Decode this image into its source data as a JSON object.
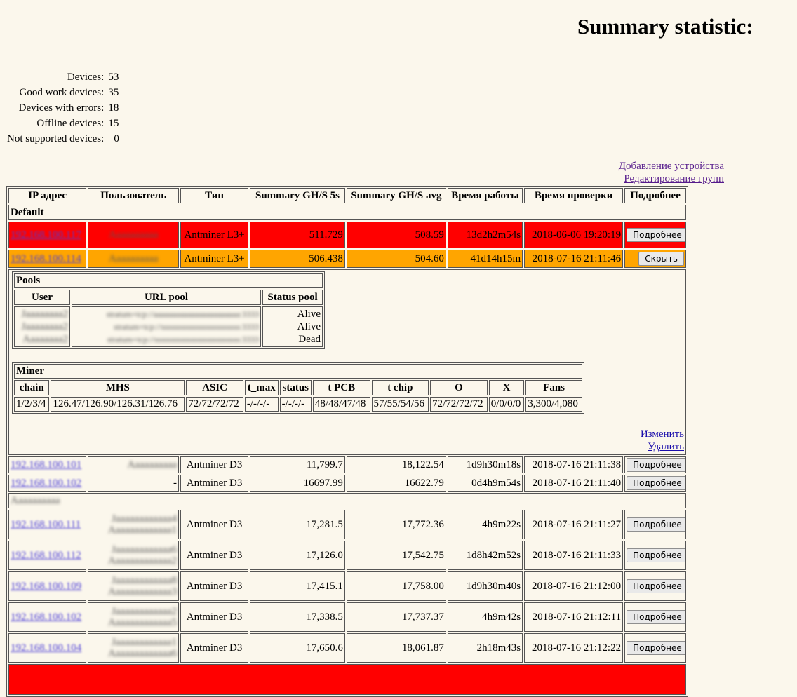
{
  "page": {
    "title": "Summary statistic:"
  },
  "stats": [
    {
      "label": "Devices:",
      "value": "53"
    },
    {
      "label": "Good work devices:",
      "value": "35"
    },
    {
      "label": "Devices with errors:",
      "value": "18"
    },
    {
      "label": "Offline devices:",
      "value": "15"
    },
    {
      "label": "Not supported devices:",
      "value": "0"
    }
  ],
  "links": {
    "add_device": "Добавление устройства",
    "edit_groups": "Редактирование групп"
  },
  "columns": [
    "IP адрес",
    "Пользователь",
    "Тип",
    "Summary GH/S 5s",
    "Summary GH/S avg",
    "Время работы",
    "Время проверки",
    "Подробнее"
  ],
  "groups": {
    "default": "Default",
    "second_masked": "Аааааааааа"
  },
  "rows": [
    {
      "ip": "192.168.100.117",
      "user": "Аааааааааа",
      "type": "Antminer L3+",
      "gh5s": "511.729",
      "ghavg": "508.59",
      "uptime": "13d2h2m54s",
      "checked": "2018-06-06 19:20:19",
      "btn": "Подробнее",
      "status": "red"
    },
    {
      "ip": "192.168.100.114",
      "user": "Аааааааааа",
      "type": "Antminer L3+",
      "gh5s": "506.438",
      "ghavg": "504.60",
      "uptime": "41d14h15m",
      "checked": "2018-07-16 21:11:46",
      "btn": "Скрыть",
      "status": "orange"
    },
    {
      "ip": "192.168.100.101",
      "user": "Аааааааааа",
      "type": "Antminer D3",
      "gh5s": "11,799.7",
      "ghavg": "18,122.54",
      "uptime": "1d9h30m18s",
      "checked": "2018-07-16 21:11:38",
      "btn": "Подробнее"
    },
    {
      "ip": "192.168.100.102",
      "user": "-",
      "type": "Antminer D3",
      "gh5s": "16697.99",
      "ghavg": "16622.79",
      "uptime": "0d4h9m54s",
      "checked": "2018-07-16 21:11:40",
      "btn": "Подробнее"
    },
    {
      "ip": "192.168.100.111",
      "user": "Jаааааааааааа4",
      "user2": "Ааааааааааааа1",
      "type": "Antminer D3",
      "gh5s": "17,281.5",
      "ghavg": "17,772.36",
      "uptime": "4h9m22s",
      "checked": "2018-07-16 21:11:27",
      "btn": "Подробнее"
    },
    {
      "ip": "192.168.100.112",
      "user": "Jаааааааааааа6",
      "user2": "Ааааааааааааа2",
      "type": "Antminer D3",
      "gh5s": "17,126.0",
      "ghavg": "17,542.75",
      "uptime": "1d8h42m52s",
      "checked": "2018-07-16 21:11:33",
      "btn": "Подробнее"
    },
    {
      "ip": "192.168.100.109",
      "user": "Jаааааааааааа8",
      "user2": "Ааааааааааааа3",
      "type": "Antminer D3",
      "gh5s": "17,415.1",
      "ghavg": "17,758.00",
      "uptime": "1d9h30m40s",
      "checked": "2018-07-16 21:12:00",
      "btn": "Подробнее"
    },
    {
      "ip": "192.168.100.102",
      "user": "Jаааааааааааа2",
      "user2": "Ааааааааааааа5",
      "type": "Antminer D3",
      "gh5s": "17,338.5",
      "ghavg": "17,737.37",
      "uptime": "4h9m42s",
      "checked": "2018-07-16 21:12:11",
      "btn": "Подробнее"
    },
    {
      "ip": "192.168.100.104",
      "user": "Jаааааааааааа1",
      "user2": "Ааааааааааааа6",
      "type": "Antminer D3",
      "gh5s": "17,650.6",
      "ghavg": "18,061.87",
      "uptime": "2h18m43s",
      "checked": "2018-07-16 21:12:22",
      "btn": "Подробнее"
    }
  ],
  "pools": {
    "caption": "Pools",
    "headers": [
      "User",
      "URL pool",
      "Status pool"
    ],
    "rows": [
      {
        "user": "Jаааааааа2",
        "url": "stratum+tcp://ааааааааааааааааааааааа:3333",
        "status": "Alive"
      },
      {
        "user": "Jаааааааа2",
        "url": "stratum+tcp://ssssssssssssssssssssssss:3333",
        "status": "Alive"
      },
      {
        "user": "Аааааааа2",
        "url": "stratum+tcp://ssssssssssssssssssssssssss:3333",
        "status": "Dead"
      }
    ]
  },
  "miner": {
    "caption": "Miner",
    "headers": [
      "chain",
      "MHS",
      "ASIC",
      "t_max",
      "status",
      "t PCB",
      "t chip",
      "O",
      "X",
      "Fans"
    ],
    "values": [
      "1/2/3/4",
      "126.47/126.90/126.31/126.76",
      "72/72/72/72",
      "-/-/-/-",
      "-/-/-/-",
      "48/48/47/48",
      "57/55/54/56",
      "72/72/72/72",
      "0/0/0/0",
      "3,300/4,080"
    ]
  },
  "actions": {
    "edit": "Изменить",
    "delete": "Удалить"
  },
  "colors": {
    "error": "#ff0000",
    "warning": "#ffa500",
    "background": "#fbf7ec"
  }
}
